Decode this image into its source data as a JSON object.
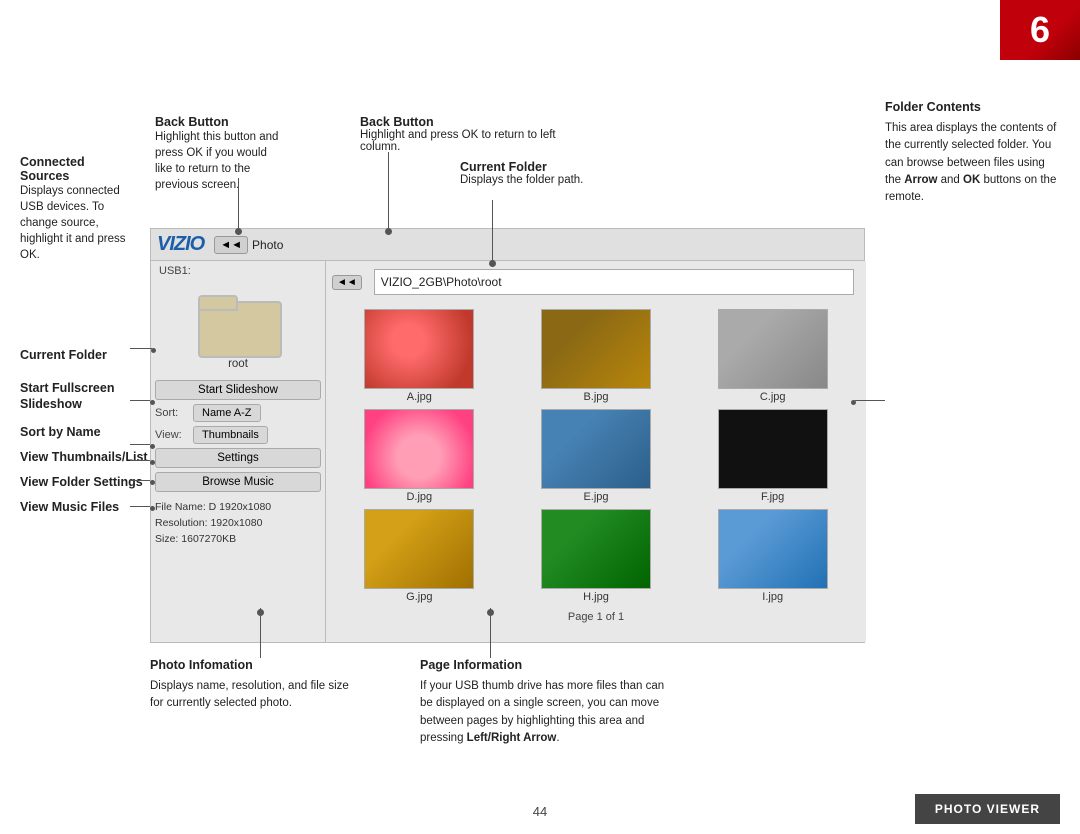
{
  "page_number": "6",
  "bottom_page": "44",
  "annotations": {
    "connected_sources": {
      "title": "Connected Sources",
      "desc": "Displays connected USB devices. To change source, highlight it and press OK."
    },
    "back_button_left": {
      "title": "Back Button",
      "desc": "Highlight this button and press OK if you would like to return to the previous screen."
    },
    "back_button_mid": {
      "title": "Back Button",
      "desc": "Highlight and press OK to return to left column."
    },
    "current_folder_label": {
      "title": "Current Folder"
    },
    "current_folder_mid": {
      "title": "Current Folder",
      "desc": "Displays the folder path."
    },
    "start_slideshow": {
      "title": "Start Fullscreen Slideshow"
    },
    "sort_by_name": {
      "title": "Sort by Name"
    },
    "view_thumbnails": {
      "title": "View Thumbnails/List"
    },
    "view_folder": {
      "title": "View Folder Settings"
    },
    "view_music": {
      "title": "View Music Files"
    },
    "folder_contents": {
      "title": "Folder Contents",
      "desc": "This area displays the contents of the currently selected folder. You can browse between files using the Arrow and OK buttons on the remote.",
      "desc_bold_1": "Arrow",
      "desc_bold_2": "OK"
    },
    "photo_info": {
      "title": "Photo Infomation",
      "desc": "Displays name, resolution, and file size for currently selected photo."
    },
    "page_info": {
      "title": "Page Information",
      "desc": "If your USB thumb drive has more files than can be displayed on a single screen, you can move between pages by highlighting this area and pressing Left/Right Arrow.",
      "desc_bold": "Left/Right Arrow"
    }
  },
  "ui": {
    "vizio_logo": "VIZIO",
    "back_btn_left": "◄◄",
    "photo_label": "Photo",
    "path_nav_btn": "◄◄",
    "path_value": "VIZIO_2GB\\Photo\\root",
    "usb_label": "USB1:",
    "folder_name": "root",
    "slideshow_btn": "Start Slideshow",
    "sort_label": "Sort:",
    "sort_btn": "Name A-Z",
    "view_label": "View:",
    "view_btn": "Thumbnails",
    "settings_btn": "Settings",
    "music_btn": "Browse Music",
    "file_name_label": "File Name: D 1920x1080",
    "resolution_label": "Resolution: 1920x1080",
    "size_label": "Size:         1607270KB",
    "photos": [
      {
        "label": "A.jpg",
        "class": "thumb-a"
      },
      {
        "label": "B.jpg",
        "class": "thumb-b"
      },
      {
        "label": "C.jpg",
        "class": "thumb-c"
      },
      {
        "label": "D.jpg",
        "class": "thumb-d"
      },
      {
        "label": "E.jpg",
        "class": "thumb-e"
      },
      {
        "label": "F.jpg",
        "class": "thumb-f"
      },
      {
        "label": "G.jpg",
        "class": "thumb-g"
      },
      {
        "label": "H.jpg",
        "class": "thumb-h"
      },
      {
        "label": "I.jpg",
        "class": "thumb-i"
      }
    ],
    "page_info_text": "Page 1 of 1"
  },
  "footer": {
    "page_number": "44",
    "photo_viewer_label": "PHOTO VIEWER"
  }
}
